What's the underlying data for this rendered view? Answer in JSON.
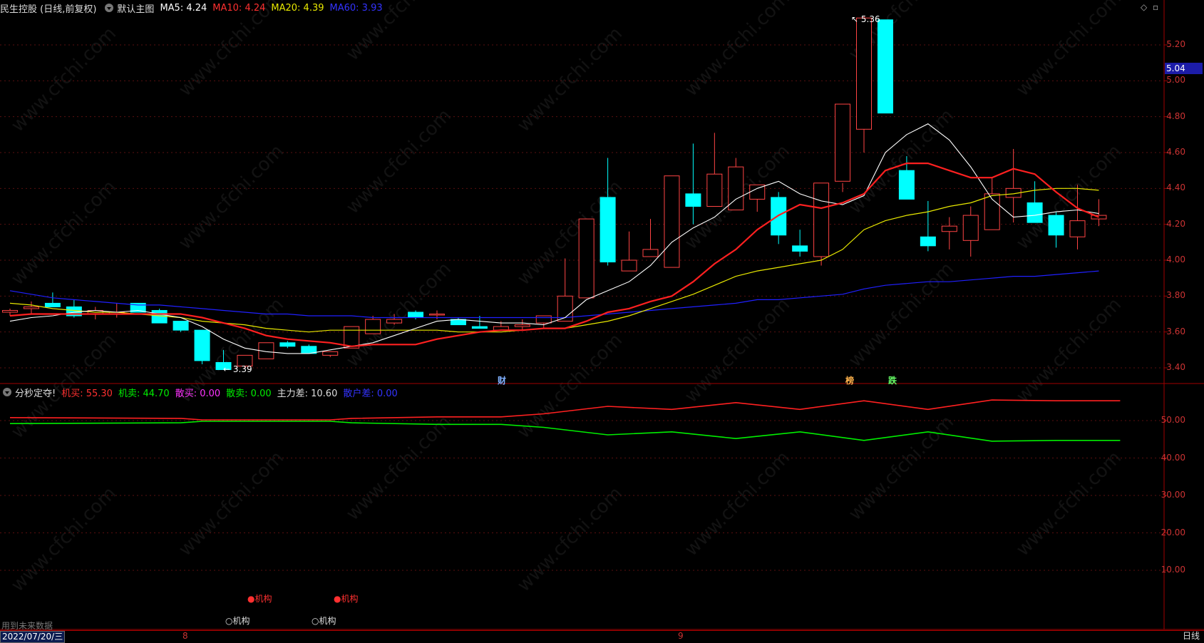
{
  "main_legend": {
    "title": "民生控股 (日线,前复权)",
    "chart_name": "默认主图",
    "ma5": "MA5: 4.24",
    "ma10": "MA10: 4.24",
    "ma20": "MA20: 4.39",
    "ma60": "MA60: 3.93"
  },
  "sub_legend": {
    "name": "分秒定夺!",
    "buy_inst": "机买: 55.30",
    "sell_inst": "机卖: 44.70",
    "buy_retail": "散买: 0.00",
    "sell_retail": "散卖: 0.00",
    "main_diff": "主力差: 10.60",
    "retail_diff": "散户差: 0.00"
  },
  "price_axis": [
    "5.20",
    "5.00",
    "4.80",
    "4.60",
    "4.40",
    "4.20",
    "4.00",
    "3.80",
    "3.60",
    "3.40"
  ],
  "current_price": "5.04",
  "sub_axis": [
    "50.00",
    "40.00",
    "30.00",
    "20.00",
    "10.00"
  ],
  "labels": {
    "high": "5.36",
    "low": "3.39",
    "event_cai": "财",
    "event_bang": "榜",
    "event_die": "跌",
    "inst_red_1": "●机构",
    "inst_red_2": "●机构",
    "inst_white_1": "○机构",
    "inst_white_2": "○机构",
    "future_data": "用到未来数据"
  },
  "bottom_bar": {
    "date": "2022/07/20/三",
    "month_8": "8",
    "month_9": "9",
    "period": "日线"
  },
  "watermark": "www.cfchi.com",
  "colors": {
    "up": "#ff4444",
    "down": "#00ffff",
    "ma5": "#ffffff",
    "ma10": "#ff2020",
    "ma20": "#e8e800",
    "ma60": "#2020ff",
    "inst_buy": "#ff2020",
    "inst_sell": "#00ee00"
  },
  "chart_data": [
    {
      "type": "candlestick",
      "title": "民生控股 (日线,前复权)",
      "y_range": [
        3.35,
        5.38
      ],
      "candles": [
        [
          3.71,
          3.73,
          3.69,
          3.72
        ],
        [
          3.73,
          3.77,
          3.7,
          3.74
        ],
        [
          3.76,
          3.82,
          3.74,
          3.74
        ],
        [
          3.74,
          3.78,
          3.68,
          3.69
        ],
        [
          3.7,
          3.74,
          3.67,
          3.72
        ],
        [
          3.7,
          3.76,
          3.68,
          3.71
        ],
        [
          3.76,
          3.76,
          3.71,
          3.71
        ],
        [
          3.72,
          3.73,
          3.65,
          3.65
        ],
        [
          3.66,
          3.66,
          3.6,
          3.61
        ],
        [
          3.61,
          3.61,
          3.42,
          3.44
        ],
        [
          3.43,
          3.5,
          3.39,
          3.39
        ],
        [
          3.41,
          3.47,
          3.4,
          3.47
        ],
        [
          3.45,
          3.54,
          3.45,
          3.54
        ],
        [
          3.54,
          3.55,
          3.51,
          3.52
        ],
        [
          3.52,
          3.53,
          3.48,
          3.48
        ],
        [
          3.47,
          3.49,
          3.46,
          3.49
        ],
        [
          3.51,
          3.63,
          3.51,
          3.63
        ],
        [
          3.59,
          3.69,
          3.59,
          3.67
        ],
        [
          3.65,
          3.7,
          3.64,
          3.67
        ],
        [
          3.71,
          3.72,
          3.67,
          3.68
        ],
        [
          3.7,
          3.72,
          3.67,
          3.7
        ],
        [
          3.67,
          3.68,
          3.64,
          3.64
        ],
        [
          3.63,
          3.69,
          3.62,
          3.62
        ],
        [
          3.61,
          3.66,
          3.61,
          3.63
        ],
        [
          3.63,
          3.67,
          3.61,
          3.64
        ],
        [
          3.65,
          3.69,
          3.62,
          3.69
        ],
        [
          3.66,
          4.01,
          3.66,
          3.8
        ],
        [
          3.79,
          4.23,
          3.79,
          4.23
        ],
        [
          4.35,
          4.57,
          3.97,
          3.99
        ],
        [
          3.94,
          4.16,
          3.94,
          4.0
        ],
        [
          4.02,
          4.23,
          4.02,
          4.06
        ],
        [
          3.96,
          4.47,
          3.96,
          4.47
        ],
        [
          4.37,
          4.65,
          4.2,
          4.3
        ],
        [
          4.3,
          4.71,
          4.3,
          4.48
        ],
        [
          4.28,
          4.57,
          4.28,
          4.52
        ],
        [
          4.34,
          4.42,
          4.27,
          4.42
        ],
        [
          4.35,
          4.38,
          4.09,
          4.14
        ],
        [
          4.08,
          4.17,
          4.02,
          4.05
        ],
        [
          4.02,
          4.43,
          3.97,
          4.43
        ],
        [
          4.44,
          4.43,
          4.38,
          4.87
        ],
        [
          4.73,
          5.36,
          4.6,
          5.35
        ],
        [
          5.34,
          5.34,
          4.82,
          4.82
        ],
        [
          4.5,
          4.58,
          4.34,
          4.34
        ],
        [
          4.13,
          4.33,
          4.05,
          4.08
        ],
        [
          4.16,
          4.24,
          4.06,
          4.19
        ],
        [
          4.11,
          4.3,
          4.02,
          4.25
        ],
        [
          4.17,
          4.46,
          4.17,
          4.37
        ],
        [
          4.35,
          4.62,
          4.21,
          4.4
        ],
        [
          4.32,
          4.44,
          4.21,
          4.21
        ],
        [
          4.25,
          4.27,
          4.07,
          4.14
        ],
        [
          4.13,
          4.42,
          4.06,
          4.22
        ],
        [
          4.23,
          4.34,
          4.19,
          4.25
        ]
      ],
      "ma5": [
        3.66,
        3.68,
        3.69,
        3.71,
        3.72,
        3.71,
        3.72,
        3.7,
        3.68,
        3.63,
        3.56,
        3.51,
        3.49,
        3.48,
        3.48,
        3.5,
        3.52,
        3.54,
        3.58,
        3.62,
        3.66,
        3.67,
        3.66,
        3.65,
        3.65,
        3.64,
        3.68,
        3.78,
        3.83,
        3.88,
        3.97,
        4.1,
        4.18,
        4.24,
        4.34,
        4.4,
        4.44,
        4.37,
        4.33,
        4.31,
        4.36,
        4.6,
        4.7,
        4.76,
        4.67,
        4.52,
        4.34,
        4.24,
        4.25,
        4.27,
        4.28,
        4.26
      ],
      "ma10": [
        3.69,
        3.7,
        3.7,
        3.7,
        3.7,
        3.7,
        3.7,
        3.7,
        3.7,
        3.68,
        3.65,
        3.62,
        3.58,
        3.56,
        3.55,
        3.54,
        3.52,
        3.53,
        3.53,
        3.53,
        3.56,
        3.58,
        3.6,
        3.61,
        3.61,
        3.62,
        3.62,
        3.66,
        3.71,
        3.73,
        3.77,
        3.8,
        3.88,
        3.98,
        4.06,
        4.17,
        4.25,
        4.31,
        4.29,
        4.32,
        4.37,
        4.5,
        4.54,
        4.54,
        4.5,
        4.46,
        4.46,
        4.51,
        4.48,
        4.38,
        4.29,
        4.24
      ],
      "ma20": [
        3.76,
        3.75,
        3.73,
        3.72,
        3.71,
        3.71,
        3.7,
        3.69,
        3.68,
        3.66,
        3.65,
        3.64,
        3.62,
        3.61,
        3.6,
        3.61,
        3.61,
        3.61,
        3.61,
        3.61,
        3.61,
        3.6,
        3.6,
        3.6,
        3.61,
        3.62,
        3.62,
        3.64,
        3.66,
        3.69,
        3.73,
        3.77,
        3.81,
        3.86,
        3.91,
        3.94,
        3.96,
        3.98,
        4.0,
        4.06,
        4.17,
        4.22,
        4.25,
        4.27,
        4.3,
        4.32,
        4.36,
        4.37,
        4.39,
        4.4,
        4.4,
        4.39
      ],
      "ma60": [
        3.83,
        3.81,
        3.79,
        3.78,
        3.77,
        3.76,
        3.75,
        3.75,
        3.74,
        3.73,
        3.72,
        3.71,
        3.7,
        3.7,
        3.69,
        3.69,
        3.69,
        3.68,
        3.68,
        3.68,
        3.68,
        3.68,
        3.68,
        3.68,
        3.68,
        3.68,
        3.68,
        3.69,
        3.7,
        3.71,
        3.72,
        3.73,
        3.74,
        3.75,
        3.76,
        3.78,
        3.78,
        3.79,
        3.8,
        3.81,
        3.84,
        3.86,
        3.87,
        3.88,
        3.88,
        3.89,
        3.9,
        3.91,
        3.91,
        3.92,
        3.93,
        3.94
      ]
    },
    {
      "type": "line",
      "title": "分秒定夺!",
      "y_range": [
        0,
        62
      ],
      "x_index": [
        0,
        8,
        9,
        15,
        16,
        20,
        23,
        25,
        28,
        31,
        34,
        37,
        40,
        43,
        46,
        49,
        52
      ],
      "series": [
        {
          "name": "机买",
          "values": [
            50.8,
            50.6,
            50.2,
            50.2,
            50.6,
            51.0,
            51.0,
            51.8,
            53.8,
            53.0,
            54.8,
            53.0,
            55.3,
            53.0,
            55.5,
            55.3,
            55.3
          ]
        },
        {
          "name": "机卖",
          "values": [
            49.2,
            49.4,
            49.8,
            49.8,
            49.4,
            49.0,
            49.0,
            48.2,
            46.2,
            47.0,
            45.2,
            47.0,
            44.7,
            47.0,
            44.5,
            44.7,
            44.7
          ]
        }
      ]
    }
  ]
}
